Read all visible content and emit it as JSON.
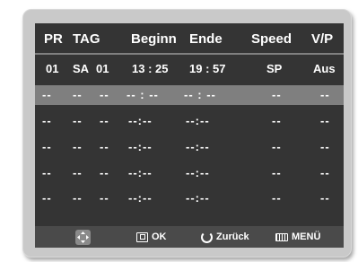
{
  "header": {
    "pr": "PR",
    "tag": "TAG",
    "beginn": "Beginn",
    "ende": "Ende",
    "speed": "Speed",
    "vp": "V/P"
  },
  "entries": [
    {
      "pr": "01",
      "tag": "SA",
      "day": "01",
      "beginn": "13 : 25",
      "ende": "19 : 57",
      "speed": "SP",
      "vp": "Aus"
    },
    {
      "pr": "--",
      "tag": "--",
      "day": "--",
      "beginn": "-- : --",
      "ende": "-- : --",
      "speed": "--",
      "vp": "--"
    },
    {
      "pr": "--",
      "tag": "--",
      "day": "--",
      "beginn": "--:--",
      "ende": "--:--",
      "speed": "--",
      "vp": "--"
    },
    {
      "pr": "--",
      "tag": "--",
      "day": "--",
      "beginn": "--:--",
      "ende": "--:--",
      "speed": "--",
      "vp": "--"
    },
    {
      "pr": "--",
      "tag": "--",
      "day": "--",
      "beginn": "--:--",
      "ende": "--:--",
      "speed": "--",
      "vp": "--"
    },
    {
      "pr": "--",
      "tag": "--",
      "day": "--",
      "beginn": "--:--",
      "ende": "--:--",
      "speed": "--",
      "vp": "--"
    }
  ],
  "footer": {
    "ok_label": "OK",
    "back_label": "Zurück",
    "menu_label": "MENÜ",
    "nav_icon": "direction-pad-icon",
    "ok_icon": "ok-button-icon",
    "back_icon": "return-icon",
    "menu_icon": "menu-button-icon"
  },
  "colors": {
    "screen_bg": "#343434",
    "highlight_row": "#7f7f7f",
    "footer_bg": "#4a4a4a",
    "text": "#ffffff"
  }
}
